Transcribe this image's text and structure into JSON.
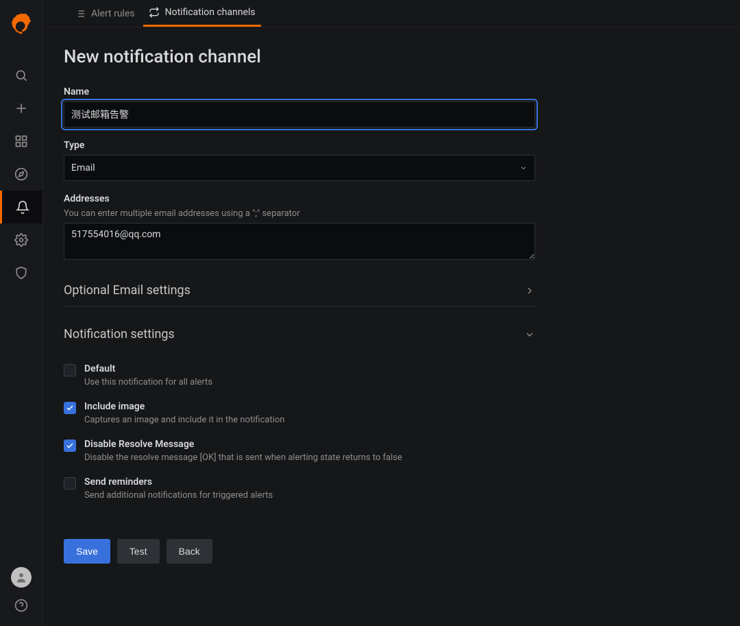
{
  "tabs": {
    "alert_rules": "Alert rules",
    "notification_channels": "Notification channels"
  },
  "page": {
    "title": "New notification channel"
  },
  "fields": {
    "name_label": "Name",
    "name_value": "测试邮箱告警",
    "type_label": "Type",
    "type_value": "Email",
    "addresses_label": "Addresses",
    "addresses_sub": "You can enter multiple email addresses using a \";\" separator",
    "addresses_value": "517554016@qq.com"
  },
  "sections": {
    "optional_email": "Optional Email settings",
    "notification_settings": "Notification settings"
  },
  "notification_settings": {
    "default": {
      "label": "Default",
      "desc": "Use this notification for all alerts",
      "checked": false
    },
    "include_image": {
      "label": "Include image",
      "desc": "Captures an image and include it in the notification",
      "checked": true
    },
    "disable_resolve": {
      "label": "Disable Resolve Message",
      "desc": "Disable the resolve message [OK] that is sent when alerting state returns to false",
      "checked": true
    },
    "send_reminders": {
      "label": "Send reminders",
      "desc": "Send additional notifications for triggered alerts",
      "checked": false
    }
  },
  "buttons": {
    "save": "Save",
    "test": "Test",
    "back": "Back"
  }
}
